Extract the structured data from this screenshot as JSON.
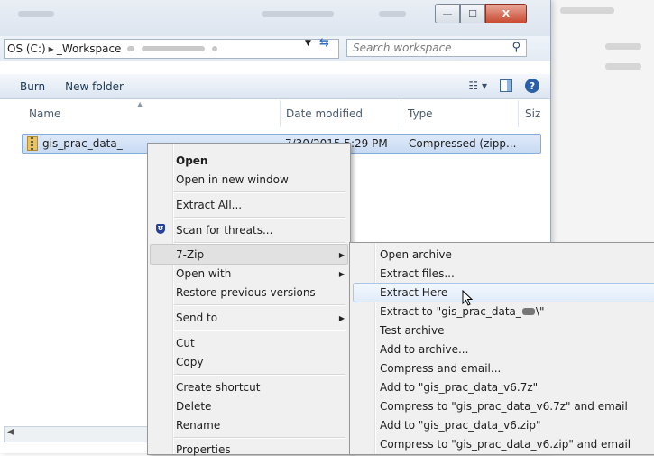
{
  "window": {
    "caption_buttons": {
      "minimize": "—",
      "maximize": "☐",
      "close": "X"
    }
  },
  "address": {
    "drive": "OS (C:)",
    "folder": "_Workspace",
    "search_placeholder": "Search workspace"
  },
  "toolbar": {
    "burn": "Burn",
    "new_folder": "New folder"
  },
  "columns": {
    "name": "Name",
    "date_modified": "Date modified",
    "type": "Type",
    "size": "Siz"
  },
  "file": {
    "name": "gis_prac_data_",
    "date": "7/30/2015 5:29 PM",
    "type": "Compressed (zipp..."
  },
  "context_menu": {
    "open": "Open",
    "open_new_window": "Open in new window",
    "extract_all": "Extract All...",
    "scan": "Scan for threats...",
    "seven_zip": "7-Zip",
    "open_with": "Open with",
    "restore": "Restore previous versions",
    "send_to": "Send to",
    "cut": "Cut",
    "copy": "Copy",
    "create_shortcut": "Create shortcut",
    "delete": "Delete",
    "rename": "Rename",
    "properties": "Properties"
  },
  "submenu": {
    "open_archive": "Open archive",
    "extract_files": "Extract files...",
    "extract_here": "Extract Here",
    "extract_to": "Extract to \"gis_prac_data_",
    "extract_to_suffix": "\\\"",
    "test_archive": "Test archive",
    "add_to_archive": "Add to archive...",
    "compress_email": "Compress and email...",
    "add_7z": "Add to \"gis_prac_data_v6.7z\"",
    "compress_7z_email": "Compress to \"gis_prac_data_v6.7z\" and email",
    "add_zip": "Add to \"gis_prac_data_v6.zip\"",
    "compress_zip_email": "Compress to \"gis_prac_data_v6.zip\" and email"
  }
}
